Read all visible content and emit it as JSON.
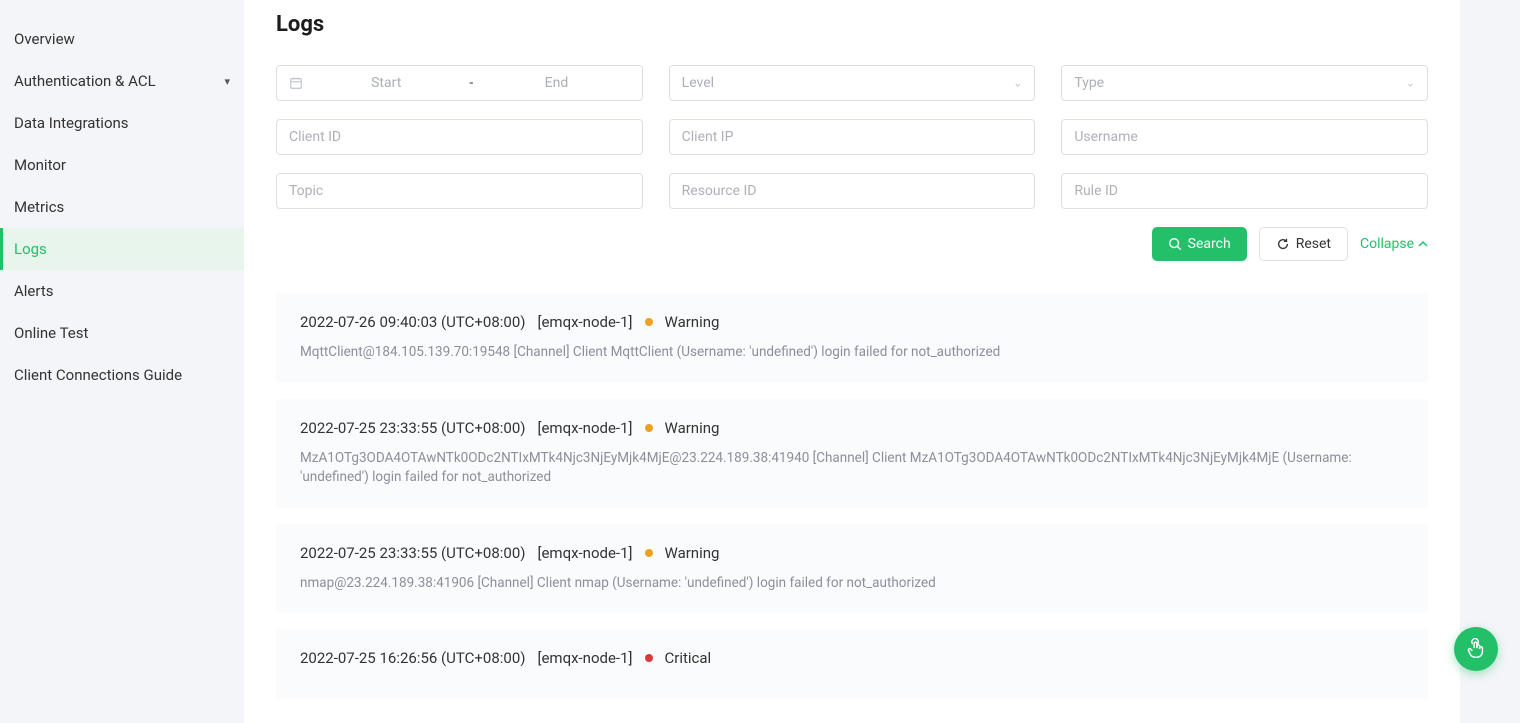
{
  "sidebar": {
    "items": [
      {
        "label": "Overview",
        "hasChevron": false
      },
      {
        "label": "Authentication & ACL",
        "hasChevron": true
      },
      {
        "label": "Data Integrations",
        "hasChevron": false
      },
      {
        "label": "Monitor",
        "hasChevron": false
      },
      {
        "label": "Metrics",
        "hasChevron": false
      },
      {
        "label": "Logs",
        "hasChevron": false,
        "active": true
      },
      {
        "label": "Alerts",
        "hasChevron": false
      },
      {
        "label": "Online Test",
        "hasChevron": false
      },
      {
        "label": "Client Connections Guide",
        "hasChevron": false
      }
    ]
  },
  "page": {
    "title": "Logs"
  },
  "filters": {
    "date_start_placeholder": "Start",
    "date_sep": "-",
    "date_end_placeholder": "End",
    "level_placeholder": "Level",
    "type_placeholder": "Type",
    "client_id_placeholder": "Client ID",
    "client_ip_placeholder": "Client IP",
    "username_placeholder": "Username",
    "topic_placeholder": "Topic",
    "resource_id_placeholder": "Resource ID",
    "rule_id_placeholder": "Rule ID"
  },
  "actions": {
    "search_label": "Search",
    "reset_label": "Reset",
    "collapse_label": "Collapse"
  },
  "logs": [
    {
      "timestamp": "2022-07-26 09:40:03 (UTC+08:00)",
      "node": "[emqx-node-1]",
      "level": "Warning",
      "level_class": "warning",
      "message": "MqttClient@184.105.139.70:19548 [Channel] Client MqttClient (Username: 'undefined') login failed for not_authorized"
    },
    {
      "timestamp": "2022-07-25 23:33:55 (UTC+08:00)",
      "node": "[emqx-node-1]",
      "level": "Warning",
      "level_class": "warning",
      "message": "MzA1OTg3ODA4OTAwNTk0ODc2NTIxMTk4Njc3NjEyMjk4MjE@23.224.189.38:41940 [Channel] Client MzA1OTg3ODA4OTAwNTk0ODc2NTIxMTk4Njc3NjEyMjk4MjE (Username: 'undefined') login failed for not_authorized"
    },
    {
      "timestamp": "2022-07-25 23:33:55 (UTC+08:00)",
      "node": "[emqx-node-1]",
      "level": "Warning",
      "level_class": "warning",
      "message": "nmap@23.224.189.38:41906 [Channel] Client nmap (Username: 'undefined') login failed for not_authorized"
    },
    {
      "timestamp": "2022-07-25 16:26:56 (UTC+08:00)",
      "node": "[emqx-node-1]",
      "level": "Critical",
      "level_class": "critical",
      "message": ""
    }
  ]
}
